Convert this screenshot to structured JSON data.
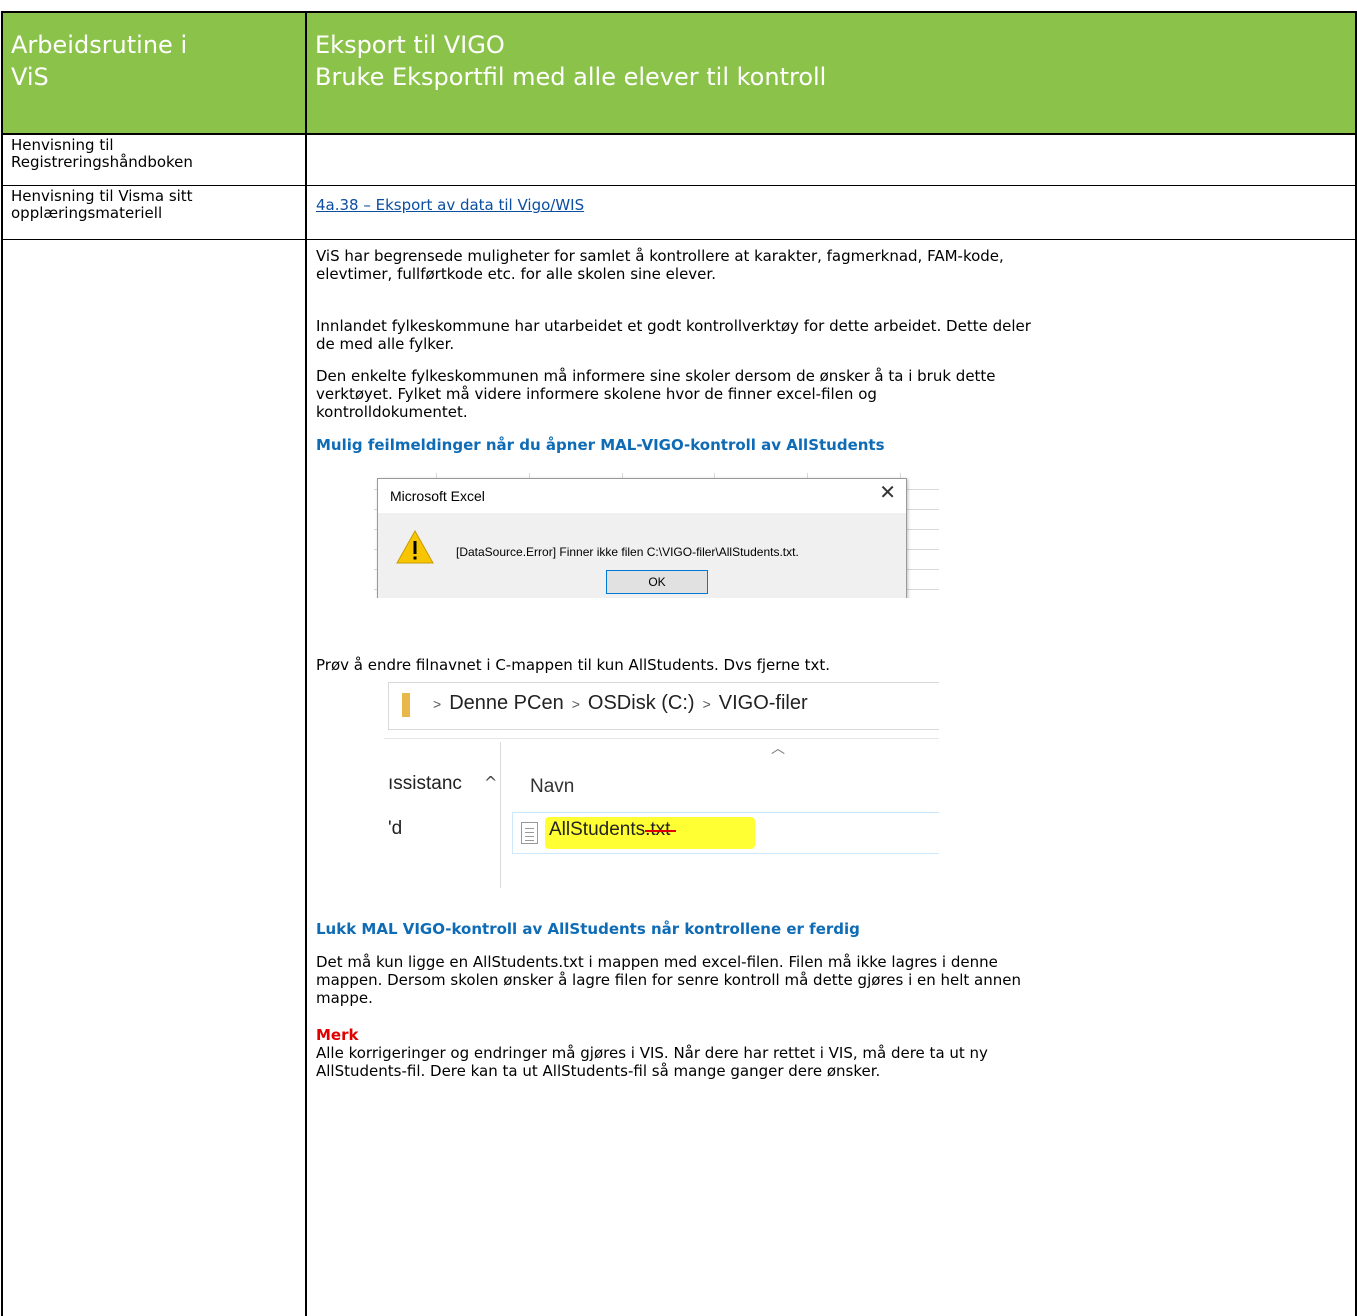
{
  "header": {
    "left_line1": "Arbeidsrutine i",
    "left_line2": "ViS",
    "right_line1": "Eksport til VIGO",
    "right_line2": "Bruke Eksportfil med alle elever til kontroll",
    "background": "#8bc34a"
  },
  "rows": {
    "reg_label_line1": "Henvisning til",
    "reg_label_line2": "Registreringshåndboken",
    "visma_label_line1": "Henvisning til Visma sitt",
    "visma_label_line2": "opplæringsmateriell",
    "visma_link": "4a.38 – Eksport av data til Vigo/WIS"
  },
  "body": {
    "p1_line1": "ViS har begrensede muligheter for samlet å kontrollere at karakter, fagmerknad, FAM-kode,",
    "p1_line2": "elevtimer, fullførtkode etc. for alle skolen sine elever.",
    "p2_line1": "Innlandet fylkeskommune har utarbeidet et godt kontrollverktøy for dette arbeidet. Dette deler",
    "p2_line2": "de med alle fylker.",
    "p3_line1": "Den enkelte fylkeskommunen må informere sine skoler dersom de ønsker å ta i bruk dette",
    "p3_line2": "verktøyet. Fylket må videre informere skolene hvor de finner excel-filen og",
    "p3_line3": "kontrolldokumentet.",
    "h1": "Mulig feilmeldinger når du åpner MAL-VIGO-kontroll av AllStudents",
    "p4": "Prøv å endre filnavnet i C-mappen til kun AllStudents. Dvs fjerne txt.",
    "h2": "Lukk MAL VIGO-kontroll av AllStudents når kontrollene er ferdig",
    "p5_line1": "Det må kun ligge en AllStudents.txt i mappen med excel-filen. Filen må ikke lagres i denne",
    "p5_line2": "mappen. Dersom skolen ønsker å lagre filen for senre kontroll må dette gjøres i en helt annen",
    "p5_line3": "mappe.",
    "merk": "Merk",
    "p6_line1": "Alle korrigeringer og endringer må gjøres i VIS. Når dere har rettet i VIS, må dere ta ut ny",
    "p6_line2": "AllStudents-fil. Dere kan ta ut AllStudents-fil så mange ganger dere ønsker."
  },
  "dialog": {
    "title": "Microsoft Excel",
    "close_glyph": "✕",
    "message": "[DataSource.Error] Finner ikke filen C:\\VIGO-filer\\AllStudents.txt.",
    "ok_label": "OK",
    "icon": "warning-icon"
  },
  "explorer": {
    "path_1": "Denne PCen",
    "path_2": "OSDisk (C:)",
    "path_3": "VIGO-filer",
    "nav_item_1": "ıssistanc",
    "nav_item_2": "'d",
    "column_header": "Navn",
    "file_base": "AllStudents",
    "file_ext": ".txt",
    "highlight_color": "#ffff33"
  }
}
